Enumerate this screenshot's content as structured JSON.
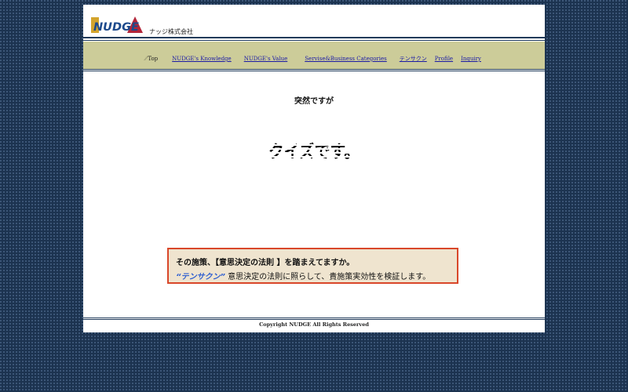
{
  "header": {
    "logo_text": "NUDGE",
    "company_name": "ナッジ株式会社"
  },
  "nav": {
    "top_label": "Top",
    "links": [
      {
        "label": "NUDGE's Knowledge"
      },
      {
        "label": "NUDGE's Value"
      },
      {
        "label": "Servise&Business Categories"
      },
      {
        "label": "テンサクン"
      },
      {
        "label": "Profile"
      },
      {
        "label": "Inquiry"
      }
    ]
  },
  "main": {
    "heading": "突然ですが",
    "quiz_text": "クイズです。",
    "callout": {
      "line1": "その施策、【意思決定の法則 】を踏まえてますか。",
      "line2_highlight": "“テンサクン”",
      "line2_rest": " 意思決定の法則に照らして、貴施策実効性を検証します。"
    }
  },
  "footer": {
    "copyright": "Copyright NUDGE All Rights Reserved"
  },
  "colors": {
    "background": "#1c3350",
    "nav_bar": "#cccc99",
    "callout_border": "#d9472a",
    "callout_fill": "#efe4cf",
    "highlight_blue": "#2f5fd0",
    "link": "#1a1aa6"
  }
}
